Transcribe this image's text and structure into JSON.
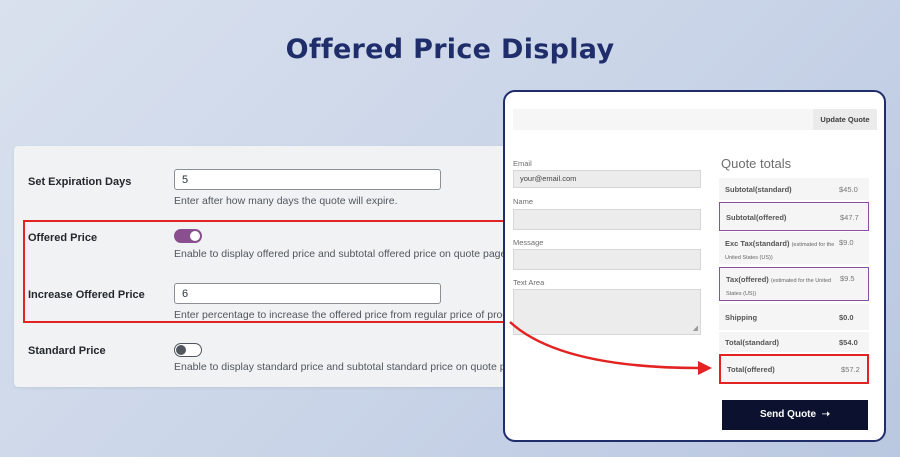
{
  "page": {
    "title": "Offered Price Display"
  },
  "settings": {
    "expiration": {
      "label": "Set Expiration Days",
      "value": "5",
      "desc": "Enter after how many days the quote will expire."
    },
    "offered_price": {
      "label": "Offered Price",
      "enabled": true,
      "desc": "Enable to display offered price and subtotal offered price on quote page"
    },
    "increase_offered_price": {
      "label": "Increase Offered Price",
      "value": "6",
      "desc": "Enter percentage to increase the offered price from regular price of product. Lea"
    },
    "standard_price": {
      "label": "Standard Price",
      "enabled": false,
      "desc": "Enable to display standard price and subtotal standard price on quote page"
    }
  },
  "quote": {
    "update_button": "Update Quote",
    "form": {
      "email_label": "Email",
      "email_value": "your@email.com",
      "name_label": "Name",
      "name_value": "",
      "message_label": "Message",
      "message_value": "",
      "textarea_label": "Text Area",
      "textarea_value": ""
    },
    "totals_title": "Quote totals",
    "totals": [
      {
        "label": "Subtotal(standard)",
        "note": "",
        "value": "$45.0"
      },
      {
        "label": "Subtotal(offered)",
        "note": "",
        "value": "$47.7"
      },
      {
        "label": "Exc Tax(standard)",
        "note": "(estimated for the United States (US))",
        "value": "$9.0"
      },
      {
        "label": "Tax(offered)",
        "note": "(estimated for the United States (US))",
        "value": "$9.5"
      },
      {
        "label": "Shipping",
        "note": "",
        "value": "$0.0"
      },
      {
        "label": "Total(standard)",
        "note": "",
        "value": "$54.0"
      },
      {
        "label": "Total(offered)",
        "note": "",
        "value": "$57.2"
      }
    ],
    "send_button": "Send Quote",
    "send_icon": "arrow-right-icon"
  },
  "colors": {
    "title": "#1f2d6b",
    "toggle_on": "#8a4f8f",
    "highlight_red": "#e32222",
    "highlight_purple": "#8a4f9f",
    "send_button_bg": "#0c1130"
  }
}
